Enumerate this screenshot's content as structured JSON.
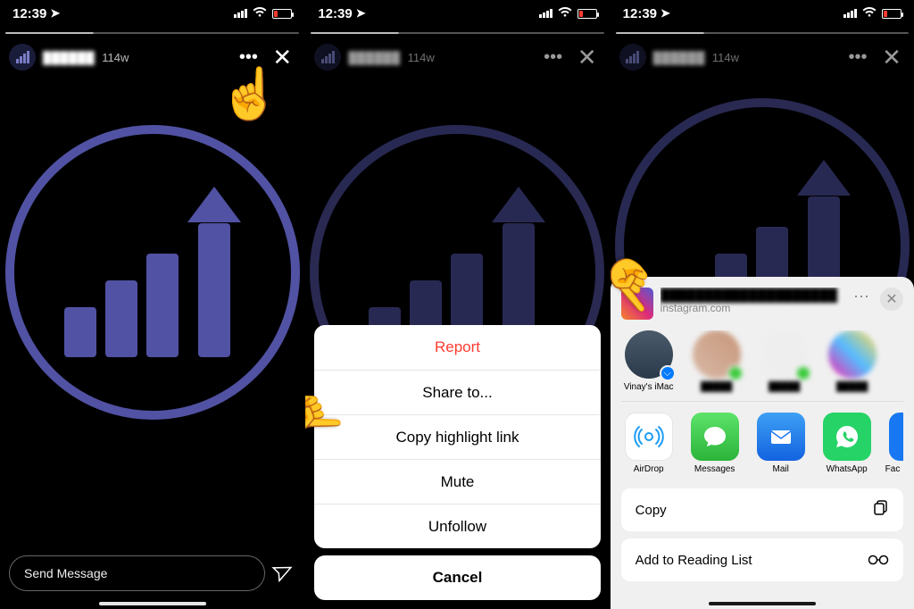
{
  "status": {
    "time": "12:39",
    "signal": "signal-icon",
    "wifi": "wifi-icon",
    "battery": "battery-low-icon"
  },
  "story": {
    "username": "██████",
    "time_ago": "114w",
    "send_placeholder": "Send Message"
  },
  "action_menu": {
    "report": "Report",
    "share": "Share to...",
    "copy_link": "Copy highlight link",
    "mute": "Mute",
    "unfollow": "Unfollow",
    "cancel": "Cancel"
  },
  "share_sheet": {
    "title": "████████████████████",
    "subtitle": "instagram.com",
    "contacts": [
      {
        "name": "Vinay's iMac",
        "blurred": false,
        "airdrop": true
      },
      {
        "name": "█████",
        "blurred": true
      },
      {
        "name": "█████",
        "blurred": true
      },
      {
        "name": "█████",
        "blurred": true
      }
    ],
    "apps": [
      {
        "name": "AirDrop",
        "color": "#ffffff",
        "fg": "#1c9cf6",
        "glyph": "◎"
      },
      {
        "name": "Messages",
        "color": "#3ccb46",
        "glyph": "✉"
      },
      {
        "name": "Mail",
        "color": "#1e77ef",
        "glyph": "✉"
      },
      {
        "name": "WhatsApp",
        "color": "#25d366",
        "glyph": "✆"
      },
      {
        "name": "Facebook",
        "color": "#1877f2",
        "glyph": "f"
      }
    ],
    "actions": {
      "copy": "Copy",
      "reading_list": "Add to Reading List"
    }
  }
}
